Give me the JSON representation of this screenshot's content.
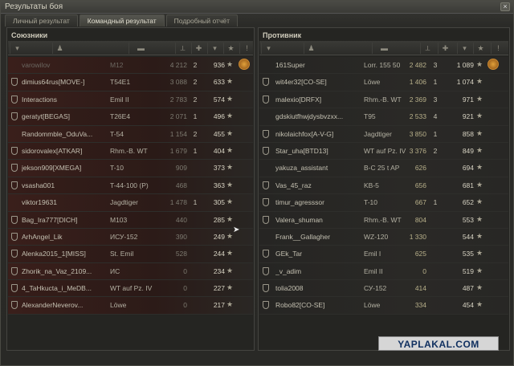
{
  "window": {
    "title": "Результаты боя"
  },
  "tabs": [
    "Личный результат",
    "Командный результат",
    "Подробный отчёт"
  ],
  "allies": {
    "title": "Союзники",
    "rows": [
      {
        "player": "varowilov",
        "tank": "M12",
        "damage": "4 212",
        "kills": "2",
        "xp": "936",
        "medal": true,
        "dead": true
      },
      {
        "player": "dimius64rus[MOVE-]",
        "tank": "T54E1",
        "damage": "3 088",
        "kills": "2",
        "xp": "633"
      },
      {
        "player": "Interactions",
        "tank": "Emil II",
        "damage": "2 783",
        "kills": "2",
        "xp": "574"
      },
      {
        "player": "geratyt[BEGAS]",
        "tank": "T26E4",
        "damage": "2 071",
        "kills": "1",
        "xp": "496"
      },
      {
        "player": "Randommble_OduVa...",
        "tank": "T-54",
        "damage": "1 154",
        "kills": "2",
        "xp": "455"
      },
      {
        "player": "sidorovalex[ATKAR]",
        "tank": "Rhm.-B. WT",
        "damage": "1 679",
        "kills": "1",
        "xp": "404"
      },
      {
        "player": "jekson909[XMEGA]",
        "tank": "T-10",
        "damage": "909",
        "kills": "",
        "xp": "373"
      },
      {
        "player": "vsasha001",
        "tank": "T-44-100 (P)",
        "damage": "468",
        "kills": "",
        "xp": "363"
      },
      {
        "player": "viktor19631",
        "tank": "Jagdtiger",
        "damage": "1 478",
        "kills": "1",
        "xp": "305"
      },
      {
        "player": "Bag_Ira777[DICH]",
        "tank": "M103",
        "damage": "440",
        "kills": "",
        "xp": "285"
      },
      {
        "player": "ArhAngel_Lik",
        "tank": "ИСУ-152",
        "damage": "390",
        "kills": "",
        "xp": "249"
      },
      {
        "player": "Alenka2015_1[MISS]",
        "tank": "St. Emil",
        "damage": "528",
        "kills": "",
        "xp": "244"
      },
      {
        "player": "Zhorik_na_Vaz_2109...",
        "tank": "ИС",
        "damage": "0",
        "kills": "",
        "xp": "234"
      },
      {
        "player": "4_TaHkucta_i_MeDB...",
        "tank": "WT auf Pz. IV",
        "damage": "0",
        "kills": "",
        "xp": "227"
      },
      {
        "player": "AlexanderNeverov...",
        "tank": "Löwe",
        "damage": "0",
        "kills": "",
        "xp": "217"
      }
    ]
  },
  "enemies": {
    "title": "Противник",
    "rows": [
      {
        "player": "161Super",
        "tank": "Lorr. 155 50",
        "damage": "2 482",
        "kills": "3",
        "xp": "1 089",
        "medal": true
      },
      {
        "player": "wit4er32[CO-SE]",
        "tank": "Löwe",
        "damage": "1 406",
        "kills": "1",
        "xp": "1 074"
      },
      {
        "player": "malexio[DRFX]",
        "tank": "Rhm.-B. WT",
        "damage": "2 369",
        "kills": "3",
        "xp": "971"
      },
      {
        "player": "gdskiutfhwjdysbvzxx...",
        "tank": "T95",
        "damage": "2 533",
        "kills": "4",
        "xp": "921"
      },
      {
        "player": "nikolaichfox[A-V-G]",
        "tank": "Jagdtiger",
        "damage": "3 850",
        "kills": "1",
        "xp": "858"
      },
      {
        "player": "Star_uha[BTD13]",
        "tank": "WT auf Pz. IV",
        "damage": "3 376",
        "kills": "2",
        "xp": "849"
      },
      {
        "player": "yakuza_assistant",
        "tank": "B-C 25 t AP",
        "damage": "626",
        "kills": "",
        "xp": "694"
      },
      {
        "player": "Vas_45_raz",
        "tank": "KB-5",
        "damage": "656",
        "kills": "",
        "xp": "681"
      },
      {
        "player": "timur_agresssor",
        "tank": "T-10",
        "damage": "667",
        "kills": "1",
        "xp": "652"
      },
      {
        "player": "Valera_shuman",
        "tank": "Rhm.-B. WT",
        "damage": "804",
        "kills": "",
        "xp": "553"
      },
      {
        "player": "Frank__Gallagher",
        "tank": "WZ-120",
        "damage": "1 330",
        "kills": "",
        "xp": "544"
      },
      {
        "player": "GEk_Tar",
        "tank": "Emil I",
        "damage": "625",
        "kills": "",
        "xp": "535"
      },
      {
        "player": "_v_adim",
        "tank": "Emil II",
        "damage": "0",
        "kills": "",
        "xp": "519"
      },
      {
        "player": "tolia2008",
        "tank": "СУ-152",
        "damage": "414",
        "kills": "",
        "xp": "487"
      },
      {
        "player": "Robo82[CO-SE]",
        "tank": "Löwe",
        "damage": "334",
        "kills": "",
        "xp": "454"
      }
    ]
  },
  "watermark": "YAPLAKAL.COM",
  "icons": {
    "clan": "shield-icon",
    "xp": "star-icon",
    "medal": "medal-icon",
    "sort": "sort-arrow-icon"
  }
}
